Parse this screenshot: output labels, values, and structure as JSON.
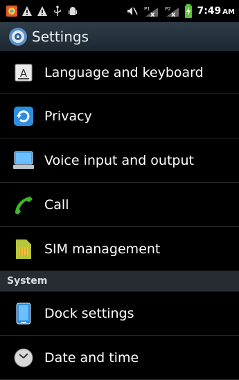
{
  "status_bar": {
    "time": "7:49",
    "ampm": "AM",
    "icons": [
      "photo-icon",
      "warning-icon",
      "warning-icon",
      "usb-icon",
      "android-debug-icon",
      "mute-icon",
      "sim1-no-signal-icon",
      "sim2-no-signal-icon",
      "battery-charging-icon"
    ],
    "sim1": "P1",
    "sim2": "P2"
  },
  "title_bar": {
    "title": "Settings",
    "icon": "settings-icon"
  },
  "items_top": [
    {
      "label": "Language and keyboard",
      "icon": "language-icon"
    },
    {
      "label": "Privacy",
      "icon": "privacy-icon"
    },
    {
      "label": "Voice input and output",
      "icon": "voice-icon"
    },
    {
      "label": "Call",
      "icon": "phone-icon"
    },
    {
      "label": "SIM management",
      "icon": "sim-icon"
    }
  ],
  "section_system": "System",
  "items_system": [
    {
      "label": "Dock settings",
      "icon": "dock-icon"
    },
    {
      "label": "Date and time",
      "icon": "clock-icon"
    }
  ],
  "colors": {
    "titlebar": "#2f3d49",
    "section": "#262c31",
    "accent_blue": "#2d8fe0",
    "accent_green": "#3fb52b"
  }
}
